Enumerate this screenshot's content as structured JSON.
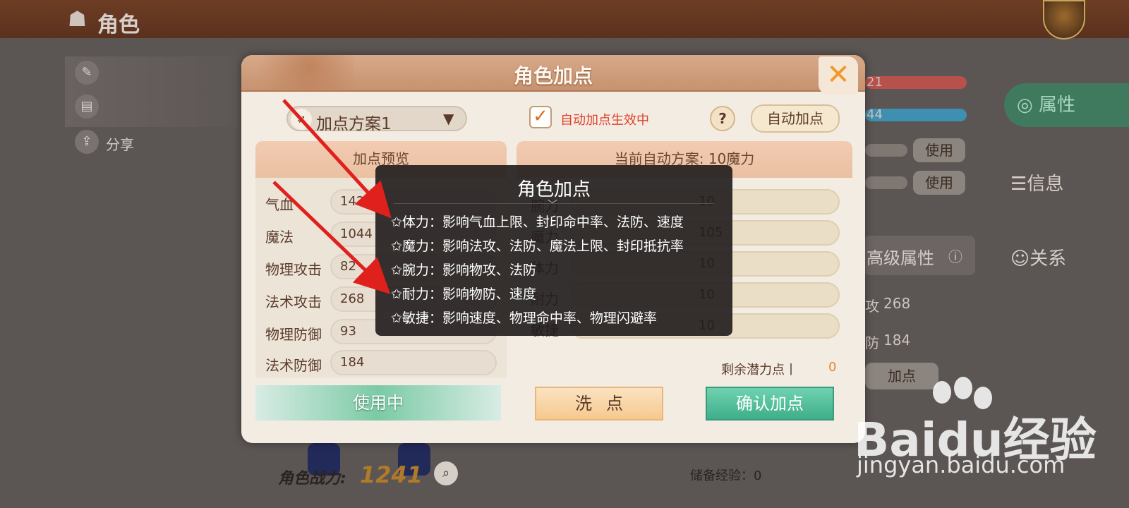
{
  "topbar": {
    "title": "角色"
  },
  "sidebar_left": [
    {
      "icon": "feather-icon",
      "label": ""
    },
    {
      "icon": "book-icon",
      "label": ""
    },
    {
      "icon": "share-icon",
      "label": "分享"
    }
  ],
  "right_panel": {
    "hp_bar_text": "21",
    "mp_bar_text": "44",
    "use_label": "使用",
    "tabs": [
      {
        "label": "属性",
        "active": true
      },
      {
        "label": "信息",
        "active": false
      },
      {
        "label": "关系",
        "active": false
      }
    ],
    "advanced_title": "高级属性",
    "adv_values": [
      {
        "label": "攻",
        "value": "268"
      },
      {
        "label": "防",
        "value": "184"
      }
    ],
    "add_point_label": "加点",
    "reserve_exp": "储备经验：0"
  },
  "bottom": {
    "combat_label": "角色战力:",
    "combat_value": "1241"
  },
  "dialog": {
    "title": "角色加点",
    "close_glyph": "✕",
    "plan_select": "加点方案1",
    "auto_check_label": "自动加点生效中",
    "help": "?",
    "auto_button": "自动加点",
    "preview": {
      "header": "加点预览",
      "stats": [
        {
          "label": "气血",
          "value": "1421"
        },
        {
          "label": "魔法",
          "value": "1044"
        },
        {
          "label": "物理攻击",
          "value": "82"
        },
        {
          "label": "法术攻击",
          "value": "268"
        },
        {
          "label": "物理防御",
          "value": "93"
        },
        {
          "label": "法术防御",
          "value": "184"
        }
      ],
      "in_use_button": "使用中"
    },
    "auto_plan": {
      "header": "当前自动方案: 10魔力",
      "attrs": [
        {
          "label": "腕力",
          "value": "10"
        },
        {
          "label": "魔力",
          "value": "105"
        },
        {
          "label": "体力",
          "value": "10"
        },
        {
          "label": "耐力",
          "value": "10"
        },
        {
          "label": "敏捷",
          "value": "10"
        }
      ],
      "remaining_label": "剩余潜力点丨",
      "remaining_value": "0",
      "wash_button": "洗点",
      "confirm_button": "确认加点"
    }
  },
  "tooltip": {
    "title": "角色加点",
    "lines": [
      "✩体力：影响气血上限、封印命中率、法防、速度",
      "✩魔力：影响法攻、法防、魔法上限、封印抵抗率",
      "✩腕力：影响物攻、法防",
      "✩耐力：影响物防、速度",
      "✩敏捷：影响速度、物理命中率、物理闪避率"
    ]
  },
  "watermark": {
    "logo": "Baidu经验",
    "url": "jingyan.baidu.com"
  },
  "colors": {
    "arrow": "#e0201c",
    "accent_green": "#3fae8a",
    "header": "#c7926f"
  }
}
